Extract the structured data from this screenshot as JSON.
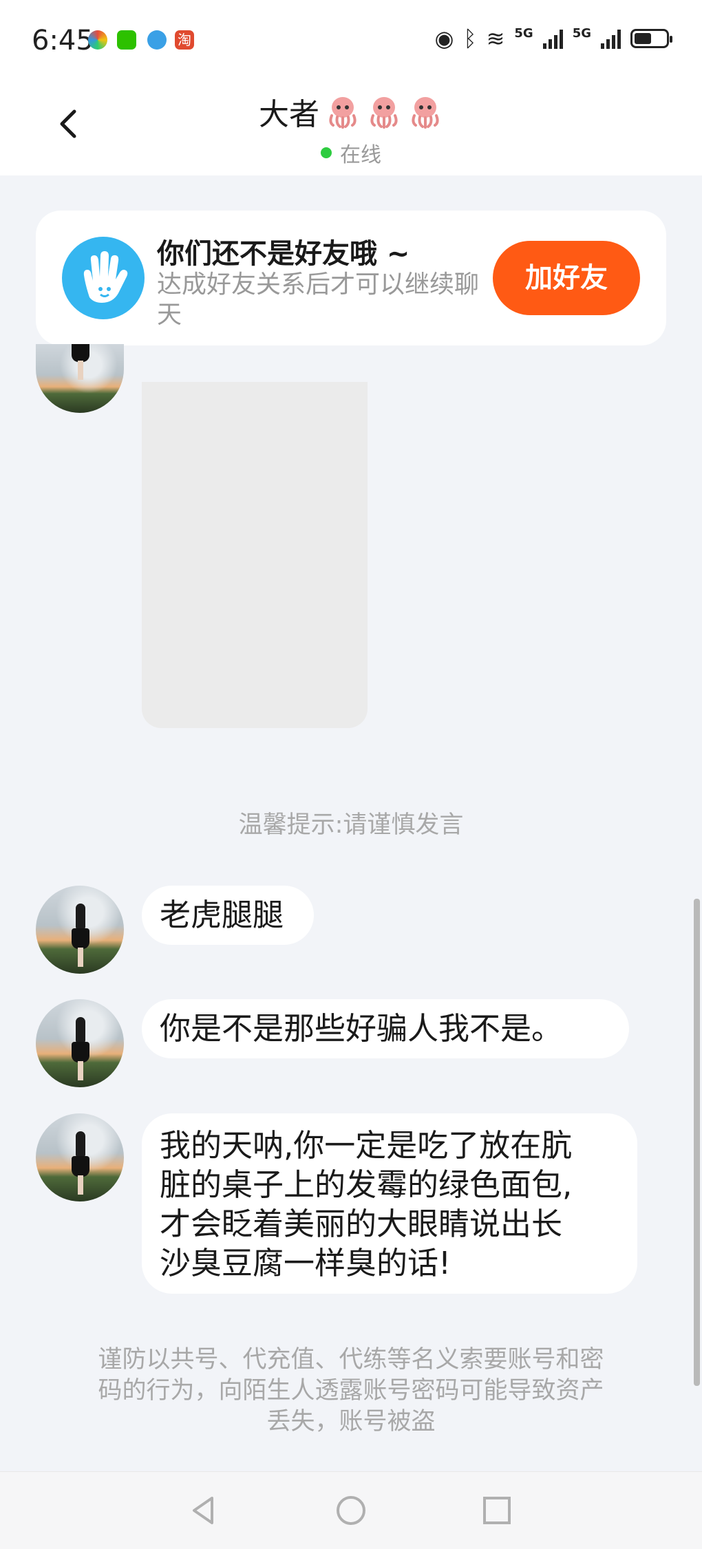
{
  "status_bar": {
    "time": "6:45",
    "taobao_label": "淘",
    "signal_1": "5G",
    "signal_2": "5G",
    "battery_level": 0.55
  },
  "header": {
    "back_icon": "chevron-left-icon",
    "name": "大者",
    "name_emojis": [
      "octopus-emoji",
      "octopus-emoji",
      "octopus-emoji"
    ],
    "status": "在线",
    "status_color": "#2ecc40"
  },
  "friend_card": {
    "icon": "waving-hand-icon",
    "title": "你们还不是好友哦 ~",
    "description": "达成好友关系后才可以继续聊天",
    "button_label": "加好友",
    "button_color": "#ff5a14"
  },
  "chat": {
    "tip": "温馨提示:请谨慎发言",
    "messages": [
      {
        "text": "老虎腿腿"
      },
      {
        "text": "你是不是那些好骗人我不是。"
      },
      {
        "text_lines": [
          "我的天呐,你一定是吃了放在肮",
          "脏的桌子上的发霉的绿色面包,",
          "才会眨着美丽的大眼睛说出长",
          "沙臭豆腐一样臭的话!"
        ]
      }
    ],
    "warning_lines": [
      "谨防以共号、代充值、代练等名义索要账号和密",
      "码的行为，向陌生人透露账号密码可能导致资产",
      "丢失，账号被盗"
    ]
  },
  "nav_bar": {
    "back": "triangle-back-icon",
    "home": "circle-home-icon",
    "recents": "square-recents-icon"
  }
}
